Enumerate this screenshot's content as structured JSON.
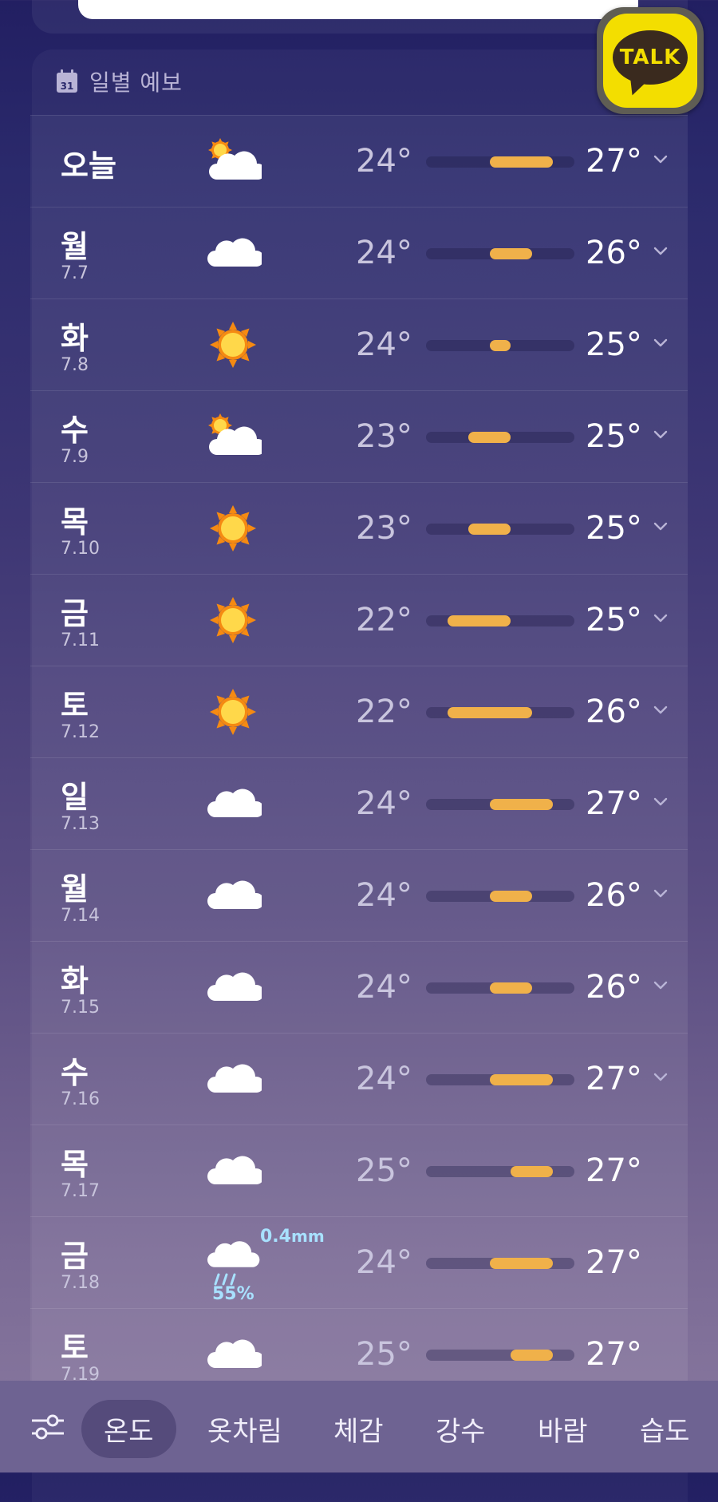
{
  "header": {
    "title": "일별 예보",
    "calendar_day": "31"
  },
  "talk_button": {
    "label": "TALK"
  },
  "colors": {
    "bar": "#f0b14a",
    "rain": "#a8e1ff",
    "talk_yellow": "#f3de00"
  },
  "forecast": [
    {
      "day": "오늘",
      "date": "",
      "icon": "partly-cloudy-icon",
      "min": "24°",
      "max": "27°",
      "min_val": 24,
      "max_val": 27,
      "expand": true
    },
    {
      "day": "월",
      "date": "7.7",
      "icon": "cloud-icon",
      "min": "24°",
      "max": "26°",
      "min_val": 24,
      "max_val": 26,
      "expand": true
    },
    {
      "day": "화",
      "date": "7.8",
      "icon": "sun-icon",
      "min": "24°",
      "max": "25°",
      "min_val": 24,
      "max_val": 25,
      "expand": true
    },
    {
      "day": "수",
      "date": "7.9",
      "icon": "partly-cloudy-icon",
      "min": "23°",
      "max": "25°",
      "min_val": 23,
      "max_val": 25,
      "expand": true
    },
    {
      "day": "목",
      "date": "7.10",
      "icon": "sun-icon",
      "min": "23°",
      "max": "25°",
      "min_val": 23,
      "max_val": 25,
      "expand": true
    },
    {
      "day": "금",
      "date": "7.11",
      "icon": "sun-icon",
      "min": "22°",
      "max": "25°",
      "min_val": 22,
      "max_val": 25,
      "expand": true
    },
    {
      "day": "토",
      "date": "7.12",
      "icon": "sun-icon",
      "min": "22°",
      "max": "26°",
      "min_val": 22,
      "max_val": 26,
      "expand": true
    },
    {
      "day": "일",
      "date": "7.13",
      "icon": "cloud-icon",
      "min": "24°",
      "max": "27°",
      "min_val": 24,
      "max_val": 27,
      "expand": true
    },
    {
      "day": "월",
      "date": "7.14",
      "icon": "cloud-icon",
      "min": "24°",
      "max": "26°",
      "min_val": 24,
      "max_val": 26,
      "expand": true
    },
    {
      "day": "화",
      "date": "7.15",
      "icon": "cloud-icon",
      "min": "24°",
      "max": "26°",
      "min_val": 24,
      "max_val": 26,
      "expand": true
    },
    {
      "day": "수",
      "date": "7.16",
      "icon": "cloud-icon",
      "min": "24°",
      "max": "27°",
      "min_val": 24,
      "max_val": 27,
      "expand": true
    },
    {
      "day": "목",
      "date": "7.17",
      "icon": "cloud-icon",
      "min": "25°",
      "max": "27°",
      "min_val": 25,
      "max_val": 27,
      "expand": false
    },
    {
      "day": "금",
      "date": "7.18",
      "icon": "rain-icon",
      "min": "24°",
      "max": "27°",
      "min_val": 24,
      "max_val": 27,
      "expand": false,
      "rain_amount": "0.4",
      "rain_unit": "mm",
      "rain_prob": "55%"
    },
    {
      "day": "토",
      "date": "7.19",
      "icon": "cloud-icon",
      "min": "25°",
      "max": "27°",
      "min_val": 25,
      "max_val": 27,
      "expand": false
    }
  ],
  "bottom_tabs": [
    {
      "label": "온도",
      "active": true
    },
    {
      "label": "옷차림",
      "active": false
    },
    {
      "label": "체감",
      "active": false
    },
    {
      "label": "강수",
      "active": false
    },
    {
      "label": "바람",
      "active": false
    },
    {
      "label": "습도",
      "active": false
    }
  ]
}
